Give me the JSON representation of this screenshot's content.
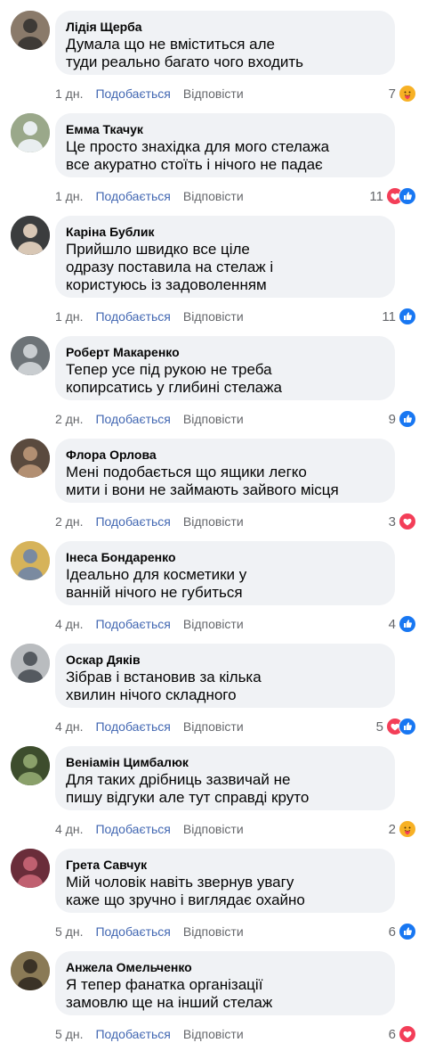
{
  "comments": [
    {
      "author": "Лідія Щерба",
      "text": "Думала що не вміститься але\nтуди реально багато чого входить",
      "time": "1 дн.",
      "like": "Подобається",
      "reply": "Відповісти",
      "count": "7",
      "reactions": [
        "care"
      ]
    },
    {
      "author": "Емма Ткачук",
      "text": "Це просто знахідка для мого стелажа\nвсе акуратно стоїть і нічого не падає",
      "time": "1 дн.",
      "like": "Подобається",
      "reply": "Відповісти",
      "count": "11",
      "reactions": [
        "love",
        "like"
      ]
    },
    {
      "author": "Каріна Бублик",
      "text": "Прийшло швидко все ціле\nодразу поставила на стелаж і\nкористуюсь із задоволенням",
      "time": "1 дн.",
      "like": "Подобається",
      "reply": "Відповісти",
      "count": "11",
      "reactions": [
        "like"
      ]
    },
    {
      "author": "Роберт Макаренко",
      "text": "Тепер усе під рукою не треба\nкопирсатись у глибині стелажа",
      "time": "2 дн.",
      "like": "Подобається",
      "reply": "Відповісти",
      "count": "9",
      "reactions": [
        "like"
      ]
    },
    {
      "author": "Флора Орлова",
      "text": "Мені подобається що ящики легко\nмити і вони не займають зайвого місця",
      "time": "2 дн.",
      "like": "Подобається",
      "reply": "Відповісти",
      "count": "3",
      "reactions": [
        "love"
      ]
    },
    {
      "author": "Інеса Бондаренко",
      "text": "Ідеально для косметики у\nванній нічого не губиться",
      "time": "4 дн.",
      "like": "Подобається",
      "reply": "Відповісти",
      "count": "4",
      "reactions": [
        "like"
      ]
    },
    {
      "author": "Оскар Дяків",
      "text": "Зібрав і встановив за кілька\nхвилин нічого складного",
      "time": "4 дн.",
      "like": "Подобається",
      "reply": "Відповісти",
      "count": "5",
      "reactions": [
        "love",
        "like"
      ]
    },
    {
      "author": "Веніамін Цимбалюк",
      "text": "Для таких дрібниць зазвичай не\nпишу відгуки але тут справді круто",
      "time": "4 дн.",
      "like": "Подобається",
      "reply": "Відповісти",
      "count": "2",
      "reactions": [
        "care"
      ]
    },
    {
      "author": "Грета Савчук",
      "text": "Мій чоловік навіть звернув увагу\nкаже що зручно і виглядає охайно",
      "time": "5 дн.",
      "like": "Подобається",
      "reply": "Відповісти",
      "count": "6",
      "reactions": [
        "like"
      ]
    },
    {
      "author": "Анжела Омельченко",
      "text": "Я тепер фанатка організації\nзамовлю ще на інший стелаж",
      "time": "5 дн.",
      "like": "Подобається",
      "reply": "Відповісти",
      "count": "6",
      "reactions": [
        "love"
      ]
    }
  ],
  "colors": {
    "like": "#1877f2",
    "love": "#f33e58",
    "care": "#f7b125",
    "link": "#4267b2",
    "meta": "#65676b",
    "bubble": "#f0f2f5"
  }
}
